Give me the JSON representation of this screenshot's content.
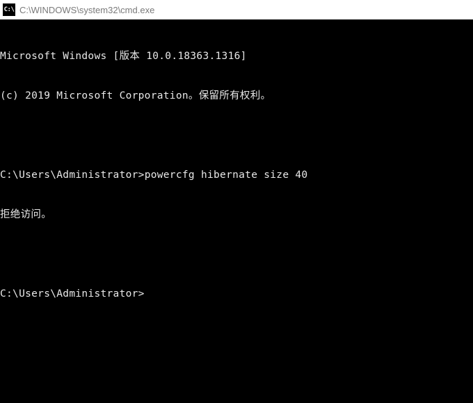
{
  "window": {
    "icon_text": "C:\\",
    "title": "C:\\WINDOWS\\system32\\cmd.exe"
  },
  "terminal": {
    "header_line1": "Microsoft Windows [版本 10.0.18363.1316]",
    "header_line2": "(c) 2019 Microsoft Corporation。保留所有权利。",
    "blank1": "",
    "prompt1": "C:\\Users\\Administrator>",
    "command1": "powercfg hibernate size 40",
    "output1": "拒绝访问。",
    "blank2": "",
    "prompt2": "C:\\Users\\Administrator>",
    "current_input": ""
  }
}
